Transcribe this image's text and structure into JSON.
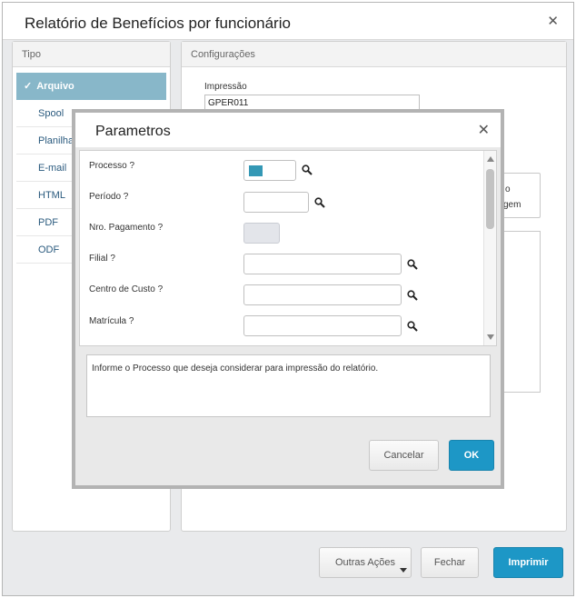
{
  "window": {
    "title": "Relatório de Benefícios por funcionário",
    "close_glyph": "✕"
  },
  "tipo_panel": {
    "header": "Tipo",
    "items": [
      {
        "label": "Arquivo",
        "active": true,
        "check": "✓"
      },
      {
        "label": "Spool"
      },
      {
        "label": "Planilha"
      },
      {
        "label": "E-mail"
      },
      {
        "label": "HTML"
      },
      {
        "label": "PDF"
      },
      {
        "label": "ODF"
      }
    ]
  },
  "config_panel": {
    "header": "Configurações",
    "impressao_label": "Impressão",
    "impressao_value": "GPER011",
    "partial_text_1": "o",
    "partial_text_2": "gem"
  },
  "footer": {
    "outras_acoes": "Outras Ações",
    "fechar": "Fechar",
    "imprimir": "Imprimir"
  },
  "modal": {
    "title": "Parametros",
    "close_glyph": "✕",
    "params": [
      {
        "label": "Processo ?",
        "value": "",
        "search_icon": "magnifier-icon"
      },
      {
        "label": "Período ?",
        "value": "",
        "search_icon": "magnifier-icon"
      },
      {
        "label": "Nro. Pagamento ?",
        "value": ""
      },
      {
        "label": "Filial ?",
        "value": "",
        "search_icon": "magnifier-icon"
      },
      {
        "label": "Centro de Custo ?",
        "value": "",
        "search_icon": "magnifier-icon"
      },
      {
        "label": "Matrícula ?",
        "value": "",
        "search_icon": "magnifier-icon"
      }
    ],
    "help_text": "Informe o Processo que deseja considerar para impressão do relatório.",
    "cancel": "Cancelar",
    "ok": "OK"
  },
  "colors": {
    "primary": "#1d97c6",
    "active_item": "#88b7c9",
    "process_fill": "#3498b5"
  }
}
